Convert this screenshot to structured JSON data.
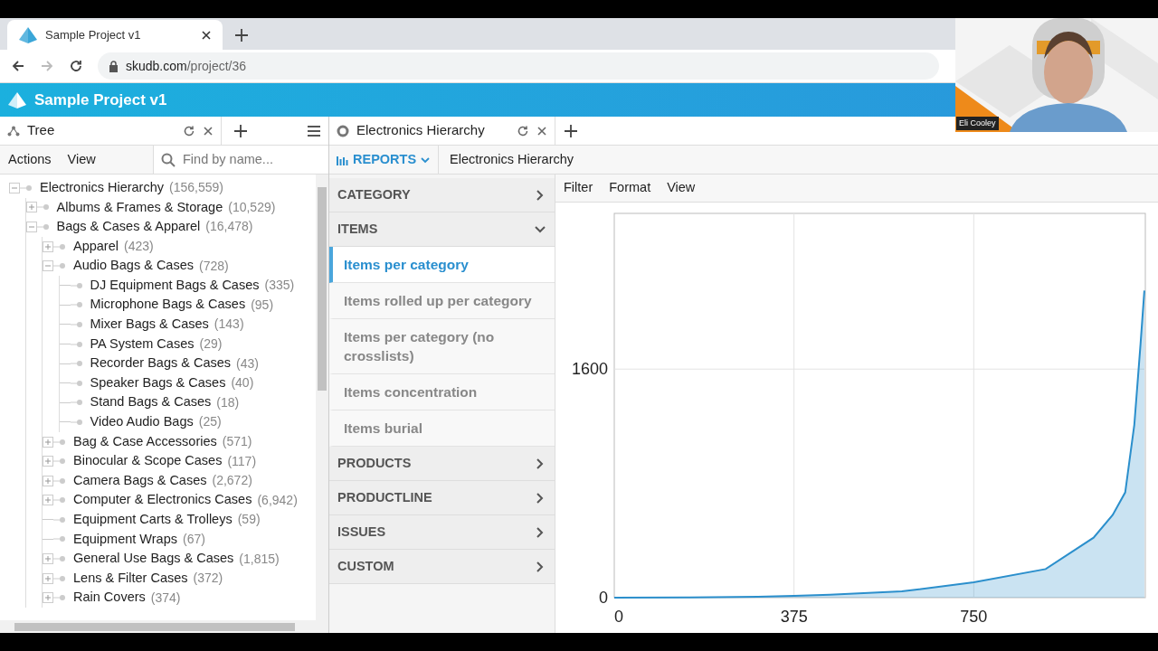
{
  "browser": {
    "tab_title": "Sample Project v1",
    "url_host": "skudb.com",
    "url_path": "/project/36"
  },
  "app": {
    "title": "Sample Project v1"
  },
  "left_pane": {
    "tab": "Tree",
    "menu": [
      "Actions",
      "View"
    ],
    "search": {
      "placeholder": "Find by name..."
    },
    "tree": [
      {
        "label": "Electronics Hierarchy",
        "count": "(156,559)",
        "kind": "group",
        "expanded": true,
        "children": [
          {
            "label": "Albums & Frames & Storage",
            "count": "(10,529)",
            "kind": "group",
            "expanded": false
          },
          {
            "label": "Bags & Cases & Apparel",
            "count": "(16,478)",
            "kind": "group",
            "expanded": true,
            "children": [
              {
                "label": "Apparel",
                "count": "(423)",
                "kind": "group",
                "expanded": false
              },
              {
                "label": "Audio Bags & Cases",
                "count": "(728)",
                "kind": "group",
                "expanded": true,
                "children": [
                  {
                    "label": "DJ Equipment Bags & Cases",
                    "count": "(335)",
                    "kind": "leaf"
                  },
                  {
                    "label": "Microphone Bags & Cases",
                    "count": "(95)",
                    "kind": "leaf"
                  },
                  {
                    "label": "Mixer Bags & Cases",
                    "count": "(143)",
                    "kind": "leaf"
                  },
                  {
                    "label": "PA System Cases",
                    "count": "(29)",
                    "kind": "leaf"
                  },
                  {
                    "label": "Recorder Bags & Cases",
                    "count": "(43)",
                    "kind": "leaf"
                  },
                  {
                    "label": "Speaker Bags & Cases",
                    "count": "(40)",
                    "kind": "leaf"
                  },
                  {
                    "label": "Stand Bags & Cases",
                    "count": "(18)",
                    "kind": "leaf"
                  },
                  {
                    "label": "Video Audio Bags",
                    "count": "(25)",
                    "kind": "leaf"
                  }
                ]
              },
              {
                "label": "Bag & Case Accessories",
                "count": "(571)",
                "kind": "group",
                "expanded": false
              },
              {
                "label": "Binocular & Scope Cases",
                "count": "(117)",
                "kind": "group",
                "expanded": false
              },
              {
                "label": "Camera Bags & Cases",
                "count": "(2,672)",
                "kind": "group",
                "expanded": false
              },
              {
                "label": "Computer & Electronics Cases",
                "count": "(6,942)",
                "kind": "group",
                "expanded": false
              },
              {
                "label": "Equipment Carts & Trolleys",
                "count": "(59)",
                "kind": "leaf"
              },
              {
                "label": "Equipment Wraps",
                "count": "(67)",
                "kind": "leaf"
              },
              {
                "label": "General Use Bags & Cases",
                "count": "(1,815)",
                "kind": "group",
                "expanded": false
              },
              {
                "label": "Lens & Filter Cases",
                "count": "(372)",
                "kind": "group",
                "expanded": false
              },
              {
                "label": "Rain Covers",
                "count": "(374)",
                "kind": "group",
                "expanded": false
              }
            ]
          }
        ]
      }
    ]
  },
  "right_pane": {
    "tab": "Electronics Hierarchy",
    "reports_button": "REPORTS",
    "breadcrumb": "Electronics Hierarchy",
    "sections": [
      {
        "label": "CATEGORY",
        "expanded": false
      },
      {
        "label": "ITEMS",
        "expanded": true,
        "items": [
          {
            "label": "Items per category",
            "selected": true
          },
          {
            "label": "Items rolled up per category",
            "selected": false
          },
          {
            "label": "Items per category (no crosslists)",
            "selected": false
          },
          {
            "label": "Items concentration",
            "selected": false
          },
          {
            "label": "Items burial",
            "selected": false
          }
        ]
      },
      {
        "label": "PRODUCTS",
        "expanded": false
      },
      {
        "label": "PRODUCTLINE",
        "expanded": false
      },
      {
        "label": "ISSUES",
        "expanded": false
      },
      {
        "label": "CUSTOM",
        "expanded": false
      }
    ],
    "chart_menu": [
      "Filter",
      "Format",
      "View"
    ],
    "chart_data": {
      "type": "area",
      "x": [
        0,
        150,
        300,
        375,
        450,
        600,
        750,
        900,
        1000,
        1040,
        1066,
        1085,
        1098,
        1106
      ],
      "series": [
        {
          "color": "#2b8fcc",
          "values": [
            0,
            1,
            6,
            12,
            20,
            44,
            107,
            200,
            420,
            580,
            737,
            1210,
            1776,
            2150
          ]
        }
      ],
      "xlim": [
        0,
        1108
      ],
      "ylim": [
        0,
        2690
      ],
      "xticks": [
        0,
        375,
        750
      ],
      "yticks": [
        0,
        1600
      ],
      "grid": true
    }
  },
  "video": {
    "name": "Eli Cooley"
  }
}
